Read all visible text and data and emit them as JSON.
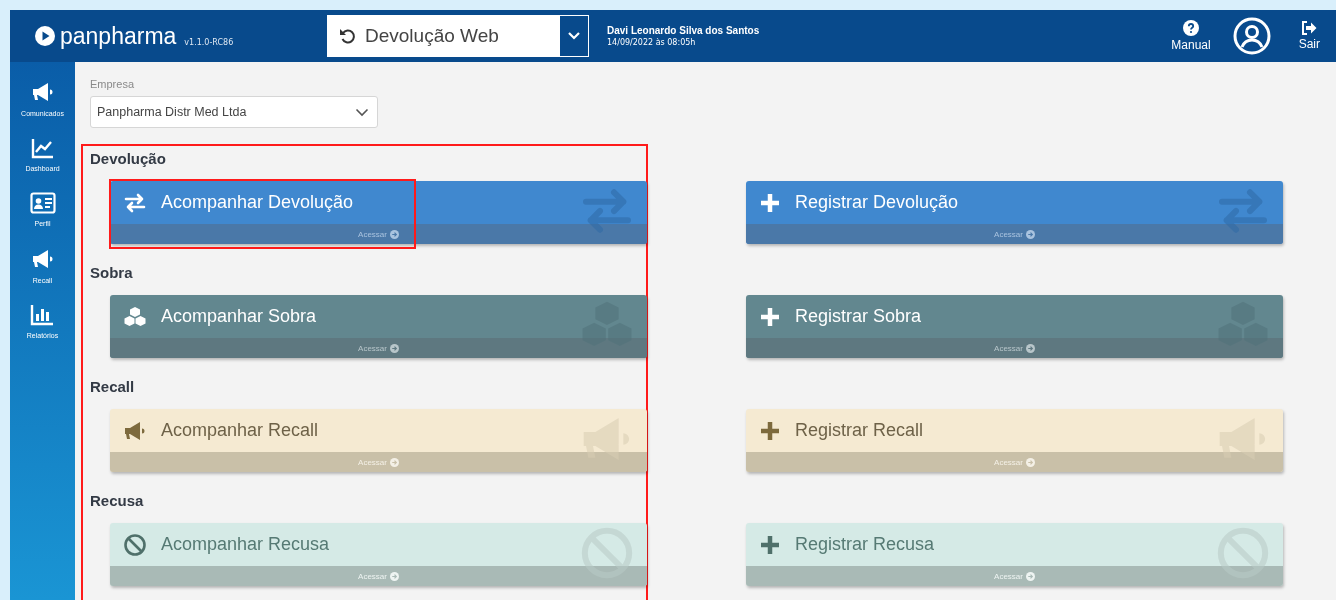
{
  "header": {
    "brand": "panpharma",
    "version": "v1.1.0-RC86",
    "module": "Devolução Web",
    "user_name": "Davi Leonardo Silva dos Santos",
    "user_date": "14/09/2022 às 08:05h",
    "manual": "Manual",
    "logout": "Sair"
  },
  "sidebar": {
    "items": [
      {
        "kind": "megaphone",
        "label": "Comunicados"
      },
      {
        "kind": "chart",
        "label": "Dashboard"
      },
      {
        "kind": "idcard",
        "label": "Perfil"
      },
      {
        "kind": "megaphone",
        "label": "Recall"
      },
      {
        "kind": "bars",
        "label": "Relatórios"
      }
    ]
  },
  "company": {
    "label": "Empresa",
    "value": "Panpharma Distr Med Ltda"
  },
  "sections": [
    {
      "kind": "devolucao",
      "title": "Devolução",
      "cards": [
        {
          "kind": "track",
          "label": "Acompanhar Devolução",
          "footer": "Acessar"
        },
        {
          "kind": "register",
          "label": "Registrar Devolução",
          "footer": "Acessar"
        }
      ]
    },
    {
      "kind": "sobra",
      "title": "Sobra",
      "cards": [
        {
          "kind": "track",
          "label": "Acompanhar Sobra",
          "footer": "Acessar"
        },
        {
          "kind": "register",
          "label": "Registrar Sobra",
          "footer": "Acessar"
        }
      ]
    },
    {
      "kind": "recall",
      "title": "Recall",
      "cards": [
        {
          "kind": "track",
          "label": "Acompanhar Recall",
          "footer": "Acessar"
        },
        {
          "kind": "register",
          "label": "Registrar Recall",
          "footer": "Acessar"
        }
      ]
    },
    {
      "kind": "recusa",
      "title": "Recusa",
      "cards": [
        {
          "kind": "track",
          "label": "Acompanhar Recusa",
          "footer": "Acessar"
        },
        {
          "kind": "register",
          "label": "Registrar Recusa",
          "footer": "Acessar"
        }
      ]
    }
  ]
}
